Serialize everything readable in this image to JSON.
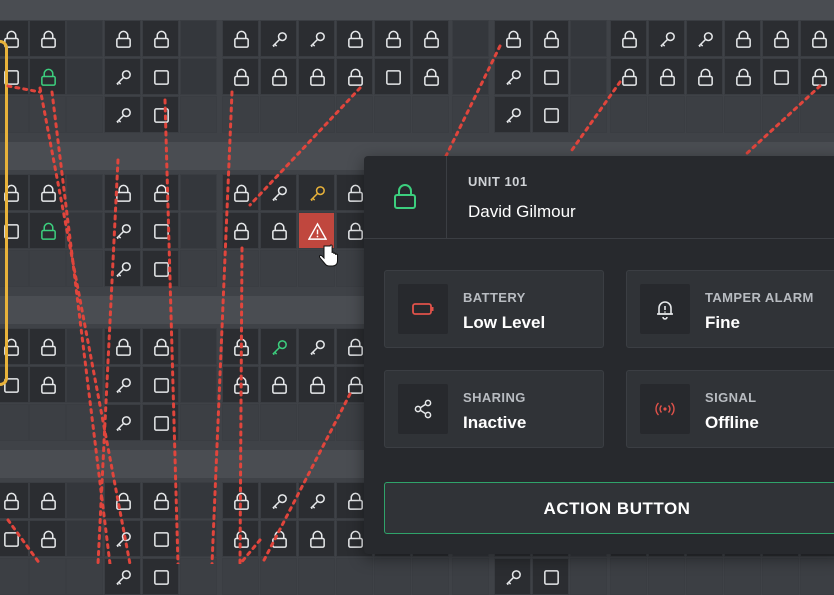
{
  "colors": {
    "lock": "#e6e8ea",
    "lock_ok": "#3ccf7e",
    "key_warn": "#e8b23a",
    "alert_bg": "#c0473e",
    "signal_red": "#e0524a",
    "battery_red": "#e0524a",
    "accent_green": "#2fa36a"
  },
  "panel": {
    "unit_label": "UNIT 101",
    "unit_name": "David Gilmour",
    "status_icon": "lock-icon",
    "cards": [
      {
        "id": "battery",
        "label": "BATTERY",
        "value": "Low Level",
        "icon": "battery-low-icon"
      },
      {
        "id": "tamper",
        "label": "TAMPER ALARM",
        "value": "Fine",
        "icon": "bell-alert-icon"
      },
      {
        "id": "sharing",
        "label": "SHARING",
        "value": "Inactive",
        "icon": "share-icon"
      },
      {
        "id": "signal",
        "label": "SIGNAL",
        "value": "Offline",
        "icon": "signal-icon"
      }
    ],
    "action_button": "ACTION BUTTON"
  }
}
